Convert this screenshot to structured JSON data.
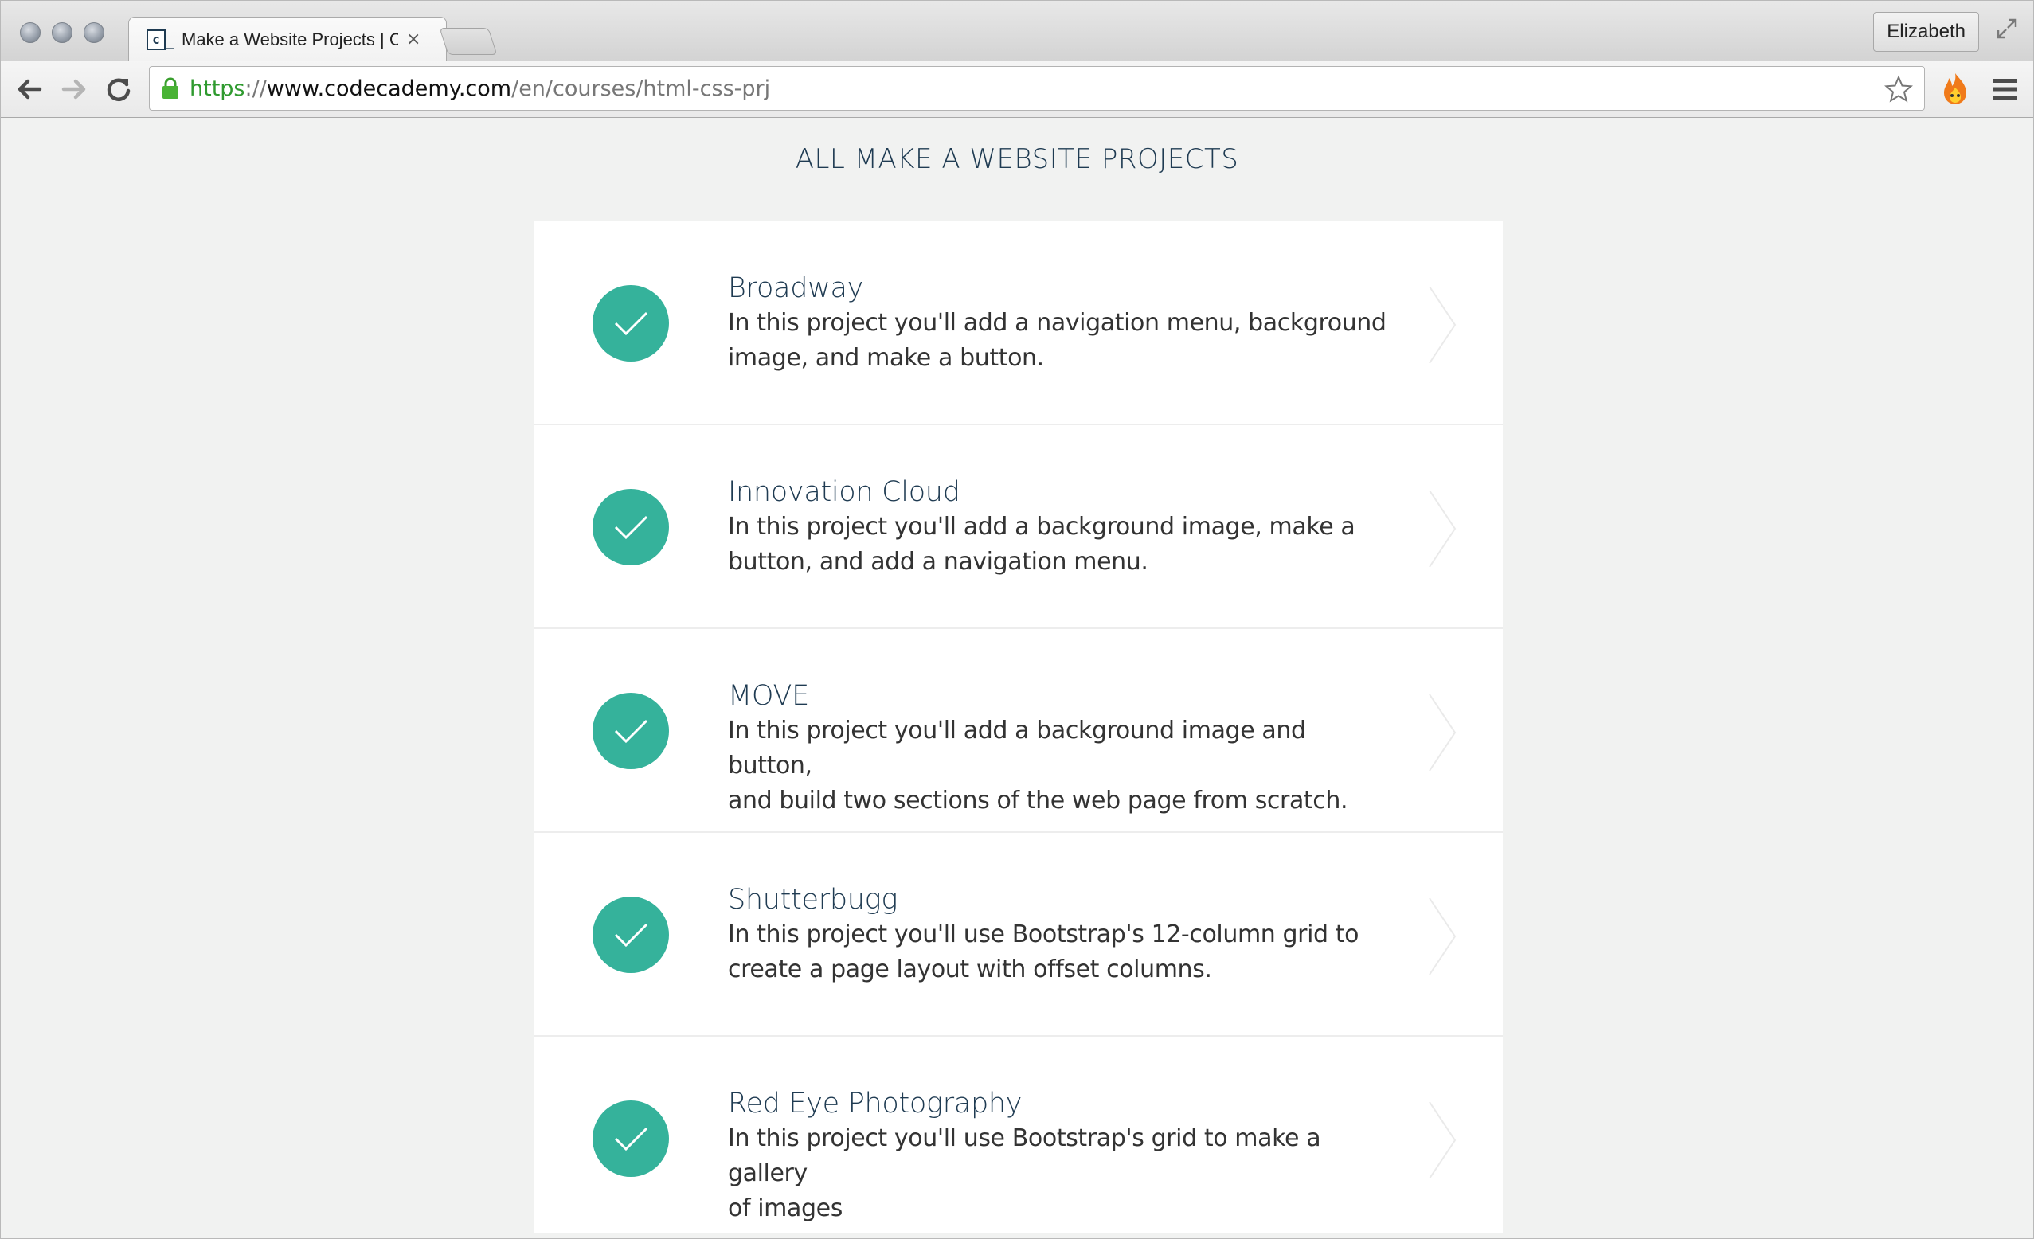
{
  "browser": {
    "tab": {
      "favicon": "c",
      "title": "Make a Website Projects | Codecademy",
      "close": "×"
    },
    "profile_name": "Elizabeth",
    "url": {
      "scheme": "https",
      "separator": "://",
      "host": "www.codecademy.com",
      "path": "/en/courses/html-css-prj"
    }
  },
  "page": {
    "title": "ALL MAKE A WEBSITE PROJECTS",
    "projects": [
      {
        "name": "Broadway",
        "description_line1": "In this project you'll add a navigation menu, background",
        "description_line2": "image, and make a button.",
        "completed": true
      },
      {
        "name": "Innovation Cloud",
        "description_line1": "In this project you'll add a background image, make a",
        "description_line2": "button, and add a navigation menu.",
        "completed": true
      },
      {
        "name": "MOVE",
        "description_line1": "In this project you'll add a background image and button,",
        "description_line2": "and build two sections of the web page from scratch.",
        "completed": true
      },
      {
        "name": "Shutterbugg",
        "description_line1": "In this project you'll use Bootstrap's 12-column grid to",
        "description_line2": "create a page layout with offset columns.",
        "completed": true
      },
      {
        "name": "Red Eye Photography",
        "description_line1": "In this project you'll use Bootstrap's grid to make a gallery",
        "description_line2": "of images",
        "completed": true
      }
    ]
  },
  "colors": {
    "accent": "#35b29b",
    "heading": "#1f3b52",
    "page_bg": "#f1f2f1"
  },
  "icons": {
    "check": "check-circle-icon",
    "chevron": "chevron-right-icon"
  }
}
